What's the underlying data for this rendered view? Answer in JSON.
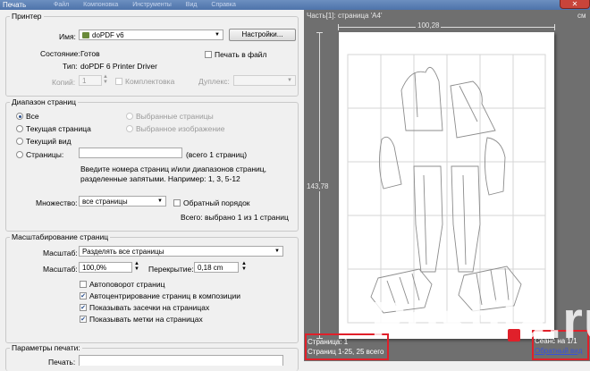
{
  "window": {
    "title": "Печать",
    "menu": [
      "Файл",
      "Компоновка",
      "Инструменты",
      "Вид",
      "Справка"
    ]
  },
  "printer": {
    "legend": "Принтер",
    "name_label": "Имя:",
    "name_value": "doPDF v6",
    "settings_button": "Настройки...",
    "status_label": "Состояние:",
    "status_value": "Готов",
    "type_label": "Тип:",
    "type_value": "doPDF  6 Printer Driver",
    "print_to_file": "Печать в файл",
    "copies_label": "Копий:",
    "copies_value": "1",
    "collate": "Комплектовка",
    "duplex_label": "Дуплекс:"
  },
  "range": {
    "legend": "Диапазон страниц",
    "all": "Все",
    "current_page": "Текущая страница",
    "current_view": "Текущий вид",
    "pages": "Страницы:",
    "selected_pages": "Выбранные страницы",
    "selected_image": "Выбранное изображение",
    "total_pages": "(всего 1 страниц)",
    "hint_line1": "Введите номера страниц и/или диапазонов страниц,",
    "hint_line2": "разделенные запятыми. Например: 1, 3, 5-12",
    "subset_label": "Множество:",
    "subset_value": "все страницы",
    "reverse_order": "Обратный порядок",
    "selected_summary": "Всего: выбрано 1 из 1 страниц"
  },
  "scaling": {
    "legend": "Масштабирование страниц",
    "scale_mode_label": "Масштаб:",
    "scale_mode_value": "Разделять все страницы",
    "scale_label": "Масштаб:",
    "scale_value": "100,0%",
    "overlap_label": "Перекрытие:",
    "overlap_value": "0,18 cm",
    "auto_rotate": "Автоповорот страниц",
    "auto_center": "Автоцентрирование страниц в композиции",
    "show_crop_marks": "Показывать засечки на страницах",
    "show_page_marks": "Показывать метки на страницах"
  },
  "print_params": {
    "legend": "Параметры печати:",
    "pages_label": "Печать:"
  },
  "preview": {
    "header": "Часть[1]: страница 'A4'",
    "units": "см",
    "width_dim": "100,28",
    "height_dim": "143,78",
    "page_info": "Страница: 1",
    "pages_total": "Страниц 1-25, 25 всего",
    "right_info": "Сеанс на 1/1",
    "link": "Обратный вид"
  },
  "watermark": {
    "text": "Postila.ru"
  },
  "colors": {
    "highlight_box": "#e0202a",
    "preview_bg": "#6f6f6f",
    "dialog_bg": "#f0f0f0"
  }
}
